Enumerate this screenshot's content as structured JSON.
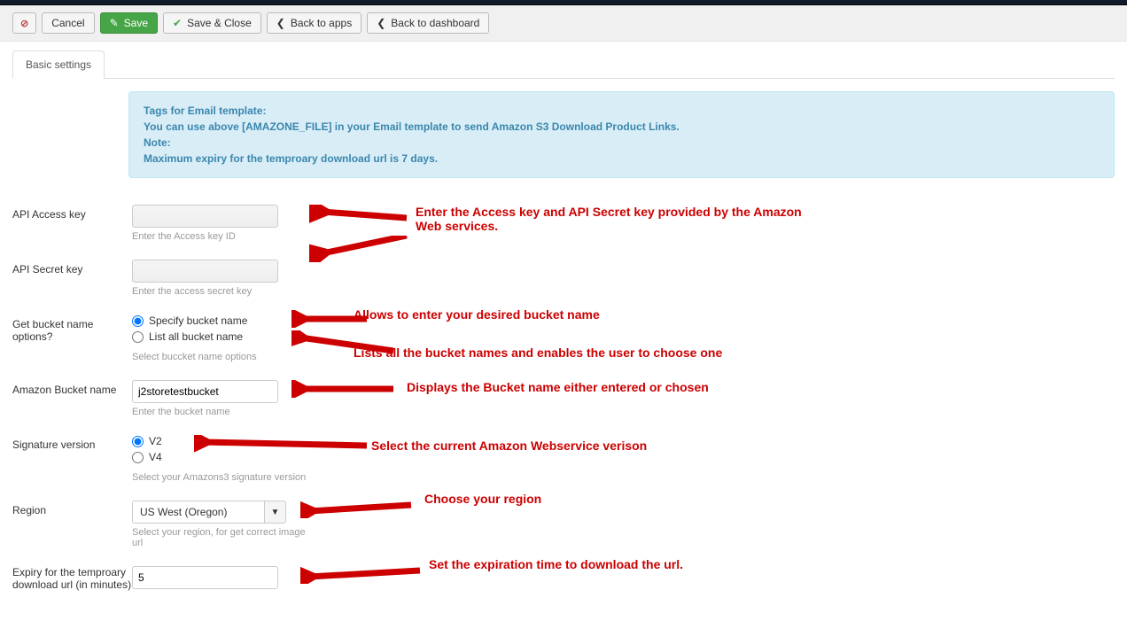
{
  "toolbar": {
    "cancel": "Cancel",
    "save": "Save",
    "save_close": "Save & Close",
    "back_apps": "Back to apps",
    "back_dash": "Back to dashboard"
  },
  "tabs": {
    "basic": "Basic settings"
  },
  "info": {
    "line1_label": "Tags for Email template:",
    "line2": "You can use above [AMAZONE_FILE] in your Email template to send Amazon S3 Download Product Links.",
    "line3_label": "Note:",
    "line4": "Maximum expiry for the temproary download url is 7 days."
  },
  "fields": {
    "access_key": {
      "label": "API Access key",
      "help": "Enter the Access key ID"
    },
    "secret_key": {
      "label": "API Secret key",
      "help": "Enter the access secret key"
    },
    "bucket_opts": {
      "label": "Get bucket name options?",
      "opt1": "Specify bucket name",
      "opt2": "List all bucket name",
      "help": "Select buccket name options"
    },
    "bucket_name": {
      "label": "Amazon Bucket name",
      "value": "j2storetestbucket",
      "help": "Enter the bucket name"
    },
    "sig_version": {
      "label": "Signature version",
      "opt1": "V2",
      "opt2": "V4",
      "help": "Select your Amazons3 signature version"
    },
    "region": {
      "label": "Region",
      "value": "US West (Oregon)",
      "help": "Select your region, for get correct image url"
    },
    "expiry": {
      "label": "Expiry for the temproary download url (in minutes)",
      "value": "5"
    }
  },
  "annotations": {
    "a1": "Enter the Access key and API Secret key provided by the Amazon Web services.",
    "a2": "Allows to enter your desired bucket name",
    "a3": "Lists all the bucket names and enables the user to choose one",
    "a4": "Displays the Bucket name either entered or chosen",
    "a5": "Select the current Amazon Webservice verison",
    "a6": "Choose your region",
    "a7": "Set the expiration time to download the url."
  }
}
